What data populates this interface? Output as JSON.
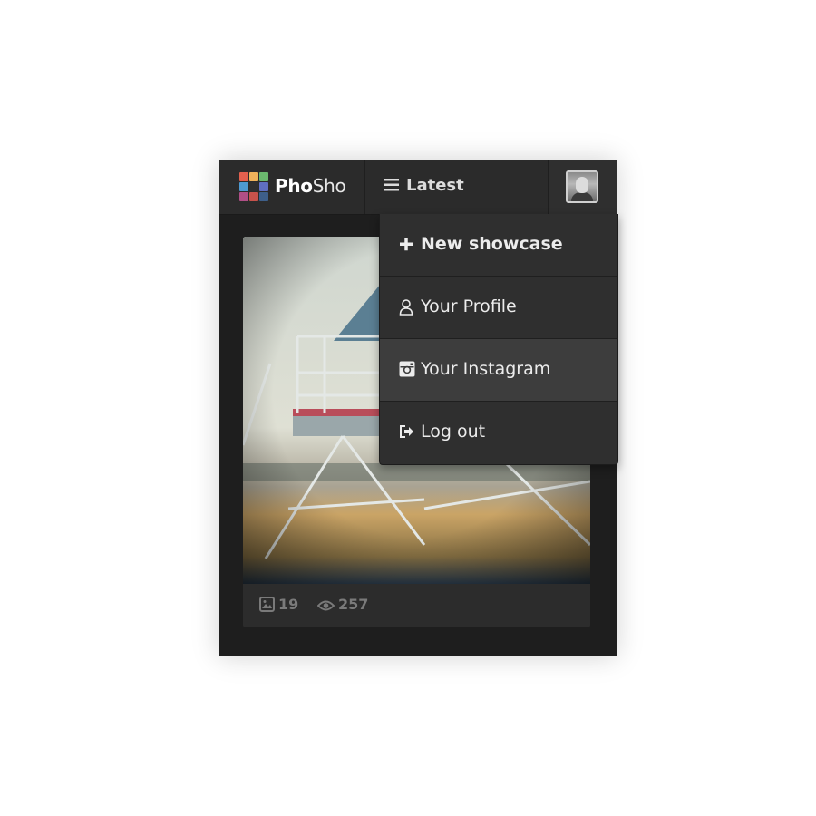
{
  "app": {
    "brand_bold": "Pho",
    "brand_light": "Sho",
    "logo_colors": [
      "#e2604e",
      "#f0b25a",
      "#6bb86e",
      "#4e9ad1",
      "#2f2f2f",
      "#5f6fc0",
      "#b04f86",
      "#c6524b",
      "#3e5f8a"
    ]
  },
  "navbar": {
    "latest_label": "Latest",
    "avatar_alt": "user avatar"
  },
  "dropdown": {
    "items": [
      {
        "label": "New showcase",
        "icon": "plus-icon"
      },
      {
        "label": "Your Profile",
        "icon": "user-icon"
      },
      {
        "label": "Your Instagram",
        "icon": "instagram-icon"
      },
      {
        "label": "Log out",
        "icon": "logout-icon"
      }
    ]
  },
  "card": {
    "photo_count": "19",
    "view_count": "257"
  }
}
